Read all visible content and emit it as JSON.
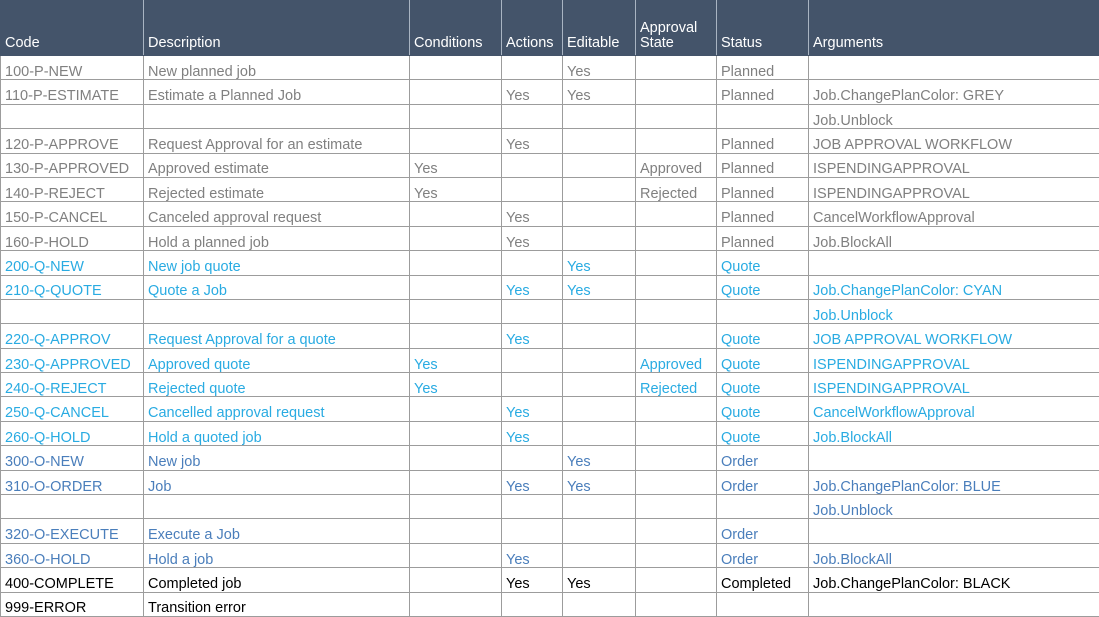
{
  "table": {
    "name": "job-workflow-transitions",
    "columns": [
      {
        "key": "code",
        "label": "Code",
        "align": "left"
      },
      {
        "key": "desc",
        "label": "Description",
        "align": "left"
      },
      {
        "key": "cond",
        "label": "Conditions",
        "align": "center"
      },
      {
        "key": "act",
        "label": "Actions",
        "align": "center"
      },
      {
        "key": "edit",
        "label": "Editable",
        "align": "center"
      },
      {
        "key": "appr",
        "label": "Approval State",
        "align": "left"
      },
      {
        "key": "stat",
        "label": "Status",
        "align": "left"
      },
      {
        "key": "args",
        "label": "Arguments",
        "align": "left"
      }
    ],
    "colors": {
      "header_bg": "#44546a",
      "header_text": "#ffffff",
      "grid": "#9c9c9c",
      "group_planned": "#808080",
      "group_quote": "#29abe2",
      "group_order": "#4a7ebb",
      "group_final": "#000000"
    },
    "rows": [
      {
        "group": "planned",
        "continuation": false,
        "code": "100-P-NEW",
        "desc": "New planned job",
        "cond": "",
        "act": "",
        "edit": "Yes",
        "appr": "",
        "stat": "Planned",
        "args": ""
      },
      {
        "group": "planned",
        "continuation": false,
        "code": "110-P-ESTIMATE",
        "desc": "Estimate a Planned Job",
        "cond": "",
        "act": "Yes",
        "edit": "Yes",
        "appr": "",
        "stat": "Planned",
        "args": "Job.ChangePlanColor: GREY"
      },
      {
        "group": "planned",
        "continuation": true,
        "code": "",
        "desc": "",
        "cond": "",
        "act": "",
        "edit": "",
        "appr": "",
        "stat": "",
        "args": "Job.Unblock"
      },
      {
        "group": "planned",
        "continuation": false,
        "code": "120-P-APPROVE",
        "desc": "Request Approval for an estimate",
        "cond": "",
        "act": "Yes",
        "edit": "",
        "appr": "",
        "stat": "Planned",
        "args": "JOB APPROVAL WORKFLOW"
      },
      {
        "group": "planned",
        "continuation": false,
        "code": "130-P-APPROVED",
        "desc": "Approved estimate",
        "cond": "Yes",
        "act": "",
        "edit": "",
        "appr": "Approved",
        "stat": "Planned",
        "args": "ISPENDINGAPPROVAL"
      },
      {
        "group": "planned",
        "continuation": false,
        "code": "140-P-REJECT",
        "desc": "Rejected estimate",
        "cond": "Yes",
        "act": "",
        "edit": "",
        "appr": "Rejected",
        "stat": "Planned",
        "args": "ISPENDINGAPPROVAL"
      },
      {
        "group": "planned",
        "continuation": false,
        "code": "150-P-CANCEL",
        "desc": "Canceled approval request",
        "cond": "",
        "act": "Yes",
        "edit": "",
        "appr": "",
        "stat": "Planned",
        "args": "CancelWorkflowApproval"
      },
      {
        "group": "planned",
        "continuation": false,
        "code": "160-P-HOLD",
        "desc": "Hold a planned job",
        "cond": "",
        "act": "Yes",
        "edit": "",
        "appr": "",
        "stat": "Planned",
        "args": "Job.BlockAll"
      },
      {
        "group": "quote",
        "continuation": false,
        "code": "200-Q-NEW",
        "desc": "New job quote",
        "cond": "",
        "act": "",
        "edit": "Yes",
        "appr": "",
        "stat": "Quote",
        "args": ""
      },
      {
        "group": "quote",
        "continuation": false,
        "code": "210-Q-QUOTE",
        "desc": "Quote a Job",
        "cond": "",
        "act": "Yes",
        "edit": "Yes",
        "appr": "",
        "stat": "Quote",
        "args": "Job.ChangePlanColor: CYAN"
      },
      {
        "group": "quote",
        "continuation": true,
        "code": "",
        "desc": "",
        "cond": "",
        "act": "",
        "edit": "",
        "appr": "",
        "stat": "",
        "args": "Job.Unblock"
      },
      {
        "group": "quote",
        "continuation": false,
        "code": "220-Q-APPROV",
        "desc": "Request Approval for a quote",
        "cond": "",
        "act": "Yes",
        "edit": "",
        "appr": "",
        "stat": "Quote",
        "args": "JOB APPROVAL WORKFLOW"
      },
      {
        "group": "quote",
        "continuation": false,
        "code": "230-Q-APPROVED",
        "desc": "Approved quote",
        "cond": "Yes",
        "act": "",
        "edit": "",
        "appr": "Approved",
        "stat": "Quote",
        "args": "ISPENDINGAPPROVAL"
      },
      {
        "group": "quote",
        "continuation": false,
        "code": "240-Q-REJECT",
        "desc": "Rejected quote",
        "cond": "Yes",
        "act": "",
        "edit": "",
        "appr": "Rejected",
        "stat": "Quote",
        "args": "ISPENDINGAPPROVAL"
      },
      {
        "group": "quote",
        "continuation": false,
        "code": "250-Q-CANCEL",
        "desc": "Cancelled approval request",
        "cond": "",
        "act": "Yes",
        "edit": "",
        "appr": "",
        "stat": "Quote",
        "args": "CancelWorkflowApproval"
      },
      {
        "group": "quote",
        "continuation": false,
        "code": "260-Q-HOLD",
        "desc": "Hold a quoted job",
        "cond": "",
        "act": "Yes",
        "edit": "",
        "appr": "",
        "stat": "Quote",
        "args": "Job.BlockAll"
      },
      {
        "group": "order",
        "continuation": false,
        "code": "300-O-NEW",
        "desc": "New job",
        "cond": "",
        "act": "",
        "edit": "Yes",
        "appr": "",
        "stat": "Order",
        "args": ""
      },
      {
        "group": "order",
        "continuation": false,
        "code": "310-O-ORDER",
        "desc": "Job",
        "cond": "",
        "act": "Yes",
        "edit": "Yes",
        "appr": "",
        "stat": "Order",
        "args": "Job.ChangePlanColor: BLUE"
      },
      {
        "group": "order",
        "continuation": true,
        "code": "",
        "desc": "",
        "cond": "",
        "act": "",
        "edit": "",
        "appr": "",
        "stat": "",
        "args": "Job.Unblock"
      },
      {
        "group": "order",
        "continuation": false,
        "code": "320-O-EXECUTE",
        "desc": "Execute a Job",
        "cond": "",
        "act": "",
        "edit": "",
        "appr": "",
        "stat": "Order",
        "args": ""
      },
      {
        "group": "order",
        "continuation": false,
        "code": "360-O-HOLD",
        "desc": "Hold a job",
        "cond": "",
        "act": "Yes",
        "edit": "",
        "appr": "",
        "stat": "Order",
        "args": "Job.BlockAll"
      },
      {
        "group": "final",
        "continuation": false,
        "code": "400-COMPLETE",
        "desc": "Completed job",
        "cond": "",
        "act": "Yes",
        "edit": "Yes",
        "appr": "",
        "stat": "Completed",
        "args": "Job.ChangePlanColor: BLACK"
      },
      {
        "group": "final",
        "continuation": false,
        "code": "999-ERROR",
        "desc": "Transition error",
        "cond": "",
        "act": "",
        "edit": "",
        "appr": "",
        "stat": "",
        "args": ""
      }
    ]
  }
}
